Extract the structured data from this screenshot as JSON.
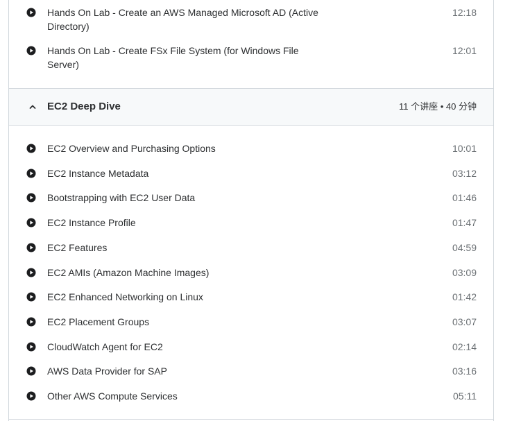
{
  "top_lectures": [
    {
      "title": "Hands On Lab - Create an AWS Managed Microsoft AD (Active Directory)",
      "duration": "12:18"
    },
    {
      "title": "Hands On Lab - Create FSx File System (for Windows File Server)",
      "duration": "12:01"
    }
  ],
  "section": {
    "title": "EC2 Deep Dive",
    "meta": "11 个讲座 • 40 分钟",
    "expanded": true,
    "lectures": [
      {
        "title": "EC2 Overview and Purchasing Options",
        "duration": "10:01"
      },
      {
        "title": "EC2 Instance Metadata",
        "duration": "03:12"
      },
      {
        "title": "Bootstrapping with EC2 User Data",
        "duration": "01:46"
      },
      {
        "title": "EC2 Instance Profile",
        "duration": "01:47"
      },
      {
        "title": "EC2 Features",
        "duration": "04:59"
      },
      {
        "title": "EC2 AMIs (Amazon Machine Images)",
        "duration": "03:09"
      },
      {
        "title": "EC2 Enhanced Networking on Linux",
        "duration": "01:42"
      },
      {
        "title": "EC2 Placement Groups",
        "duration": "03:07"
      },
      {
        "title": "CloudWatch Agent for EC2",
        "duration": "02:14"
      },
      {
        "title": "AWS Data Provider for SAP",
        "duration": "03:16"
      },
      {
        "title": "Other AWS Compute Services",
        "duration": "05:11"
      }
    ]
  },
  "icons": {
    "lecture": "play-circle-icon",
    "section_toggle": "chevron-up-icon"
  },
  "colors": {
    "text": "#2d2f31",
    "muted": "#6a6f73",
    "border": "#d1d7dc",
    "header_bg": "#f7f9fa"
  }
}
